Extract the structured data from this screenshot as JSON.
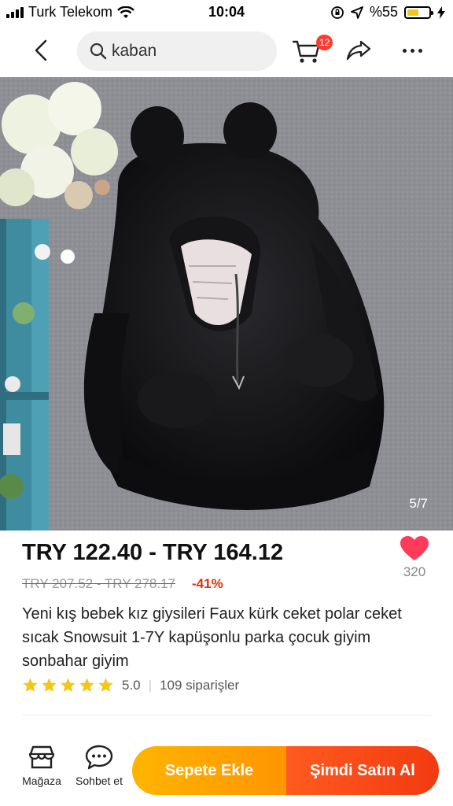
{
  "status_bar": {
    "carrier": "Turk Telekom",
    "time": "10:04",
    "battery_text": "%55",
    "battery_level": 0.55
  },
  "header": {
    "search_value": "kaban",
    "cart_count": "12"
  },
  "product": {
    "image_counter": "5/7",
    "price_range": "TRY 122.40 - TRY 164.12",
    "original_price": "TRY 207.52 - TRY 278.17",
    "discount": "-41%",
    "wishlist_count": "320",
    "title": "Yeni kış bebek kız giysileri Faux kürk ceket polar ceket sıcak Snowsuit 1-7Y kapüşonlu parka çocuk giyim sonbahar giyim",
    "rating": "5.0",
    "stars": 5,
    "orders": "109 siparişler"
  },
  "bottom_bar": {
    "store_label": "Mağaza",
    "chat_label": "Sohbet et",
    "add_to_cart_label": "Sepete Ekle",
    "buy_now_label": "Şimdi Satın Al"
  },
  "colors": {
    "accent_red": "#e62e04",
    "cart_orange": "#ffa500",
    "buy_red": "#f23b10",
    "heart": "#ff3b5c",
    "star": "#f5c518"
  },
  "icons": [
    "back-icon",
    "search-icon",
    "cart-icon",
    "share-icon",
    "more-icon",
    "heart-icon",
    "star-icon",
    "store-icon",
    "chat-icon"
  ]
}
